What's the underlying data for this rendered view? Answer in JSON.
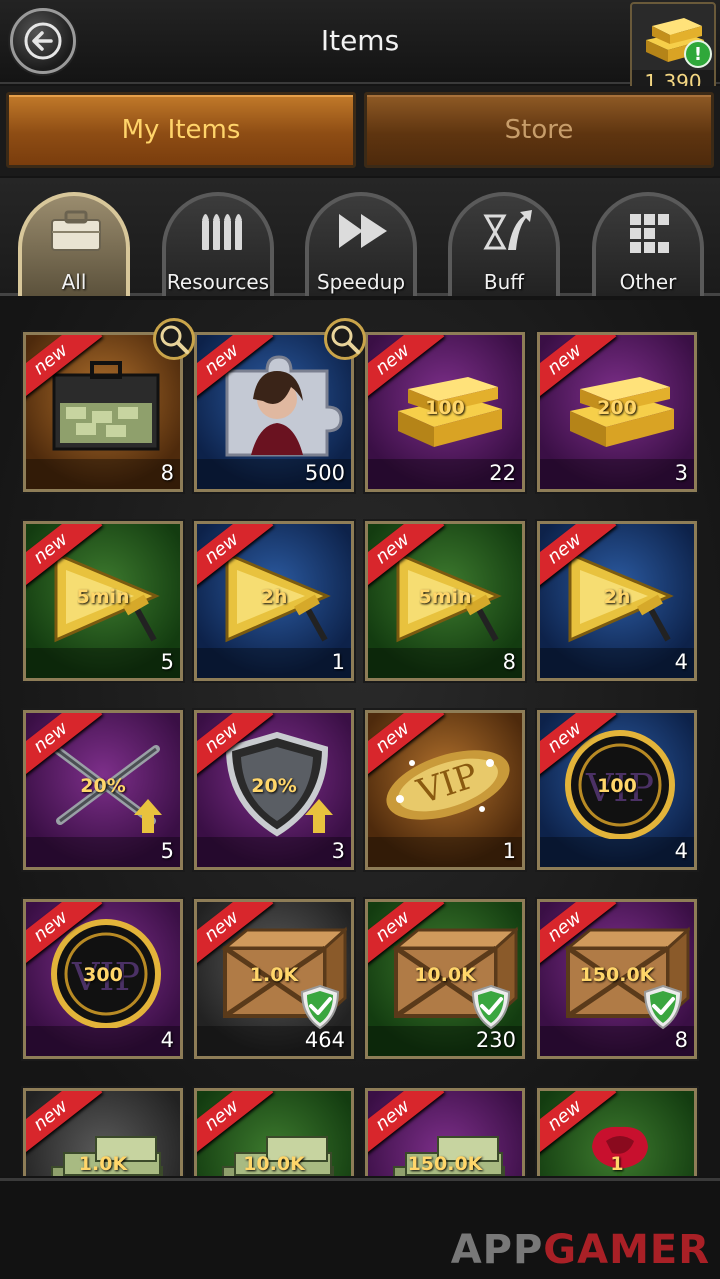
{
  "header": {
    "title": "Items",
    "gold_count": "1,390",
    "alert": "!"
  },
  "main_tabs": [
    {
      "label": "My Items",
      "active": true
    },
    {
      "label": "Store",
      "active": false
    }
  ],
  "categories": [
    {
      "label": "All",
      "icon": "briefcase-icon",
      "active": true
    },
    {
      "label": "Resources",
      "icon": "bullets-icon",
      "active": false
    },
    {
      "label": "Speedup",
      "icon": "fast-forward-icon",
      "active": false
    },
    {
      "label": "Buff",
      "icon": "hourglass-arrow-icon",
      "active": false
    },
    {
      "label": "Other",
      "icon": "blocks-icon",
      "active": false
    }
  ],
  "badge": "new",
  "items": [
    {
      "art": "cash-briefcase-icon",
      "label": "",
      "count": "8",
      "bg": "orange"
    },
    {
      "art": "puzzle-portrait-icon",
      "label": "",
      "count": "500",
      "bg": "blue"
    },
    {
      "art": "gold-bars-icon",
      "label": "100",
      "count": "22",
      "bg": "purple"
    },
    {
      "art": "gold-bars-icon",
      "label": "200",
      "count": "3",
      "bg": "purple"
    },
    {
      "art": "speedup-arrow-icon",
      "label": "5min",
      "count": "5",
      "bg": "green"
    },
    {
      "art": "speedup-arrow-icon",
      "label": "2h",
      "count": "1",
      "bg": "blue"
    },
    {
      "art": "speedup-arrow-icon",
      "label": "5min",
      "count": "8",
      "bg": "green"
    },
    {
      "art": "speedup-arrow-icon",
      "label": "2h",
      "count": "4",
      "bg": "blue"
    },
    {
      "art": "crossed-guns-icon",
      "label": "20%",
      "count": "5",
      "bg": "purple"
    },
    {
      "art": "shield-icon",
      "label": "20%",
      "count": "3",
      "bg": "purple"
    },
    {
      "art": "vip-badge-icon",
      "label": "",
      "count": "1",
      "bg": "orange"
    },
    {
      "art": "vip-coin-icon",
      "label": "100",
      "count": "4",
      "bg": "blue"
    },
    {
      "art": "vip-coin-icon",
      "label": "300",
      "count": "4",
      "bg": "purple"
    },
    {
      "art": "wooden-crate-icon",
      "label": "1.0K",
      "count": "464",
      "bg": "grey"
    },
    {
      "art": "wooden-crate-icon",
      "label": "10.0K",
      "count": "230",
      "bg": "green"
    },
    {
      "art": "wooden-crate-icon",
      "label": "150.0K",
      "count": "8",
      "bg": "purple"
    },
    {
      "art": "cash-stack-icon",
      "label": "1.0K",
      "count": "",
      "bg": "grey"
    },
    {
      "art": "cash-stack-icon",
      "label": "10.0K",
      "count": "",
      "bg": "green"
    },
    {
      "art": "cash-stack-icon",
      "label": "150.0K",
      "count": "",
      "bg": "purple"
    },
    {
      "art": "rose-icon",
      "label": "1",
      "count": "",
      "bg": "green"
    }
  ],
  "watermark": {
    "part1": "APP",
    "part2": "GAMER"
  }
}
